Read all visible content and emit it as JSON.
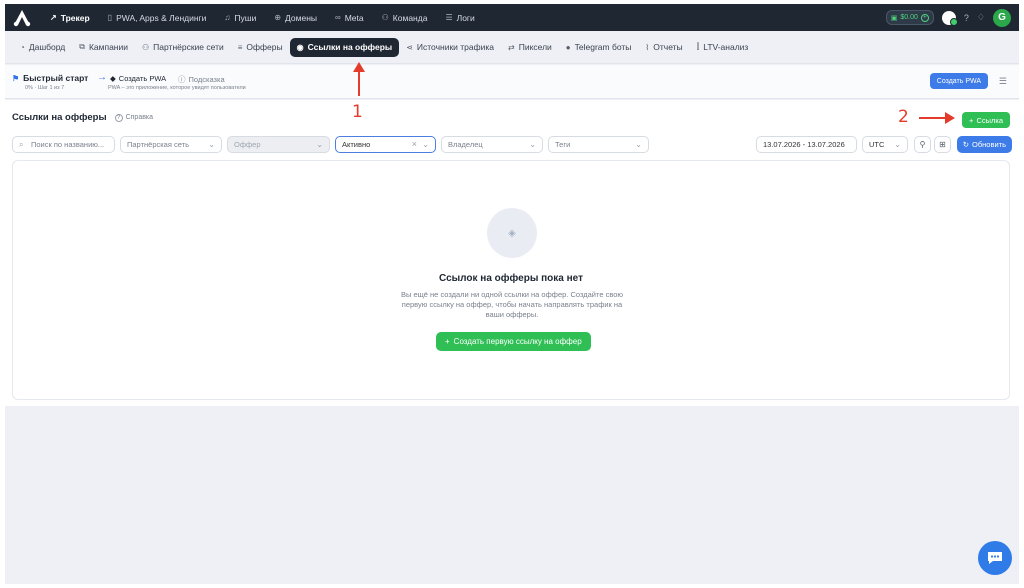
{
  "topbar": {
    "items": [
      {
        "label": "Трекер",
        "icon": "chart-line-icon",
        "active": true
      },
      {
        "label": "PWA, Apps & Лендинги",
        "icon": "phone-icon",
        "active": false
      },
      {
        "label": "Пуши",
        "icon": "bell-icon",
        "active": false
      },
      {
        "label": "Домены",
        "icon": "globe-icon",
        "active": false
      },
      {
        "label": "Meta",
        "icon": "meta-icon",
        "active": false
      },
      {
        "label": "Команда",
        "icon": "team-icon",
        "active": false
      },
      {
        "label": "Логи",
        "icon": "list-icon",
        "active": false
      }
    ],
    "balance": "$0.00",
    "avatar_letter": "G"
  },
  "subnav": {
    "items": [
      {
        "label": "Дашборд",
        "icon": "dashboard-icon",
        "active": false
      },
      {
        "label": "Кампании",
        "icon": "external-icon",
        "active": false
      },
      {
        "label": "Партнёрские сети",
        "icon": "partners-icon",
        "active": false
      },
      {
        "label": "Офферы",
        "icon": "database-icon",
        "active": false
      },
      {
        "label": "Ссылки на офферы",
        "icon": "location-pin-icon",
        "active": true
      },
      {
        "label": "Источники трафика",
        "icon": "share-icon",
        "active": false
      },
      {
        "label": "Пиксели",
        "icon": "exchange-icon",
        "active": false
      },
      {
        "label": "Telegram боты",
        "icon": "telegram-icon",
        "active": false
      },
      {
        "label": "Отчеты",
        "icon": "chart-icon",
        "active": false
      },
      {
        "label": "LTV-анализ",
        "icon": "ltv-chart-icon",
        "active": false
      }
    ]
  },
  "quickstart": {
    "title": "Быстрый старт",
    "progress": "0% · Шаг 1 из 7",
    "step_label": "Создать PWA",
    "hint_label": "Подсказка",
    "description": "PWA – это приложение, которое увидят пользователи",
    "create_pwa_label": "Создать PWA"
  },
  "main": {
    "title": "Ссылки на офферы",
    "help_label": "Справка",
    "add_link_label": "Ссылка",
    "filters": {
      "search_placeholder": "Поиск по названию...",
      "partner_network": "Партнёрская сеть",
      "offer": "Оффер",
      "status": "Активно",
      "owner": "Владелец",
      "tags": "Теги",
      "date_range": "13.07.2026 - 13.07.2026",
      "timezone": "UTC",
      "refresh_label": "Обновить"
    },
    "empty": {
      "title": "Ссылок на офферы пока нет",
      "description": "Вы ещё не создали ни одной ссылки на оффер. Создайте свою первую ссылку на оффер, чтобы начать направлять трафик на ваши офферы.",
      "button_label": "Создать первую ссылку на оффер"
    }
  },
  "annotations": {
    "marker_1": "1",
    "marker_2": "2",
    "color": "#e53b2a"
  }
}
